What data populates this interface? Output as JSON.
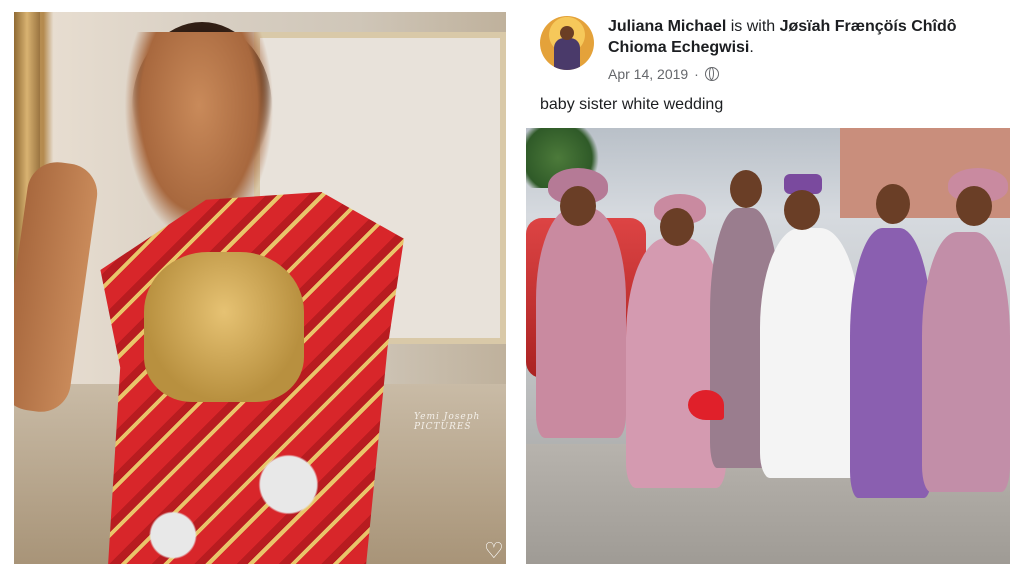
{
  "post": {
    "author": "Juliana Michael",
    "with_text": " is with ",
    "tagged": "Jøsïah Frænçöís Chîdô Chioma Echegwisi",
    "tagged_suffix": ".",
    "date": "Apr 14, 2019",
    "separator": "·",
    "privacy_icon": "globe-icon",
    "caption": "baby sister white wedding"
  },
  "left_photo": {
    "watermark": "Yemi Joseph PICTURES",
    "overlay_icon": "heart-outline-icon"
  },
  "colors": {
    "author": "#1c1e21",
    "meta": "#65676b",
    "dress_red": "#d8262a",
    "gold": "#e6c273"
  }
}
